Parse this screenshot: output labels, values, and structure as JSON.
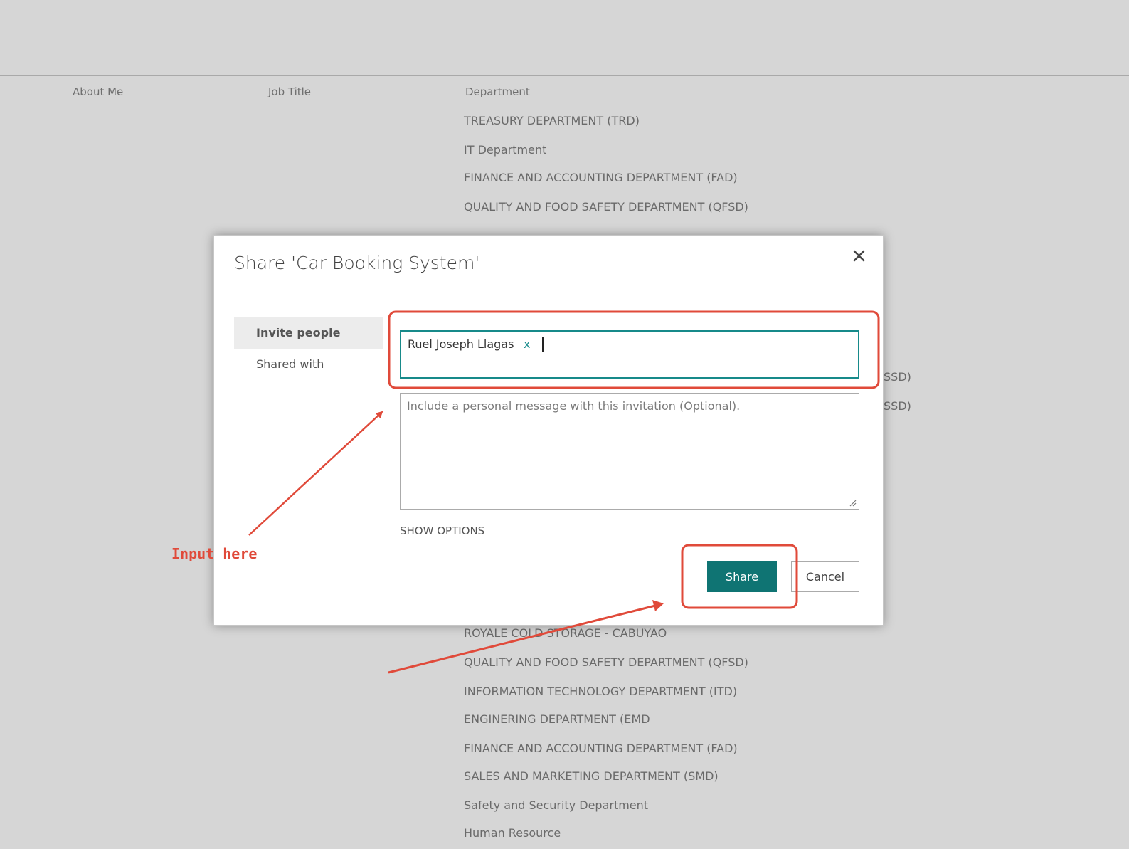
{
  "background": {
    "columns": {
      "about_me": "About Me",
      "job_title": "Job Title",
      "department": "Department"
    },
    "departments_top": [
      "TREASURY DEPARTMENT (TRD)",
      "IT Department",
      "FINANCE AND ACCOUNTING DEPARTMENT (FAD)",
      "QUALITY AND FOOD SAFETY DEPARTMENT (QFSD)"
    ],
    "departments_partial": [
      "SSD)",
      "SSD)"
    ],
    "departments_bottom": [
      "ROYALE COLD STORAGE - CABUYAO",
      "QUALITY AND FOOD SAFETY DEPARTMENT (QFSD)",
      "INFORMATION TECHNOLOGY DEPARTMENT (ITD)",
      "ENGINERING DEPARTMENT (EMD",
      "FINANCE AND ACCOUNTING DEPARTMENT (FAD)",
      "SALES AND MARKETING DEPARTMENT (SMD)",
      "Safety and Security Department",
      "Human Resource"
    ]
  },
  "dialog": {
    "title": "Share 'Car Booking System'",
    "close_icon": "close-icon",
    "nav": {
      "invite_people": "Invite people",
      "shared_with": "Shared with"
    },
    "people_picker": {
      "resolved_user": "Ruel Joseph Llagas",
      "remove_label": "x"
    },
    "message": {
      "placeholder": "Include a personal message with this invitation (Optional)."
    },
    "show_options": "SHOW OPTIONS",
    "share_label": "Share",
    "cancel_label": "Cancel"
  },
  "annotation": {
    "label": "Input here",
    "color": "#e04a3a"
  },
  "colors": {
    "accent": "#0f7473",
    "focus_border": "#178a8a",
    "backdrop": "#d6d6d6"
  }
}
